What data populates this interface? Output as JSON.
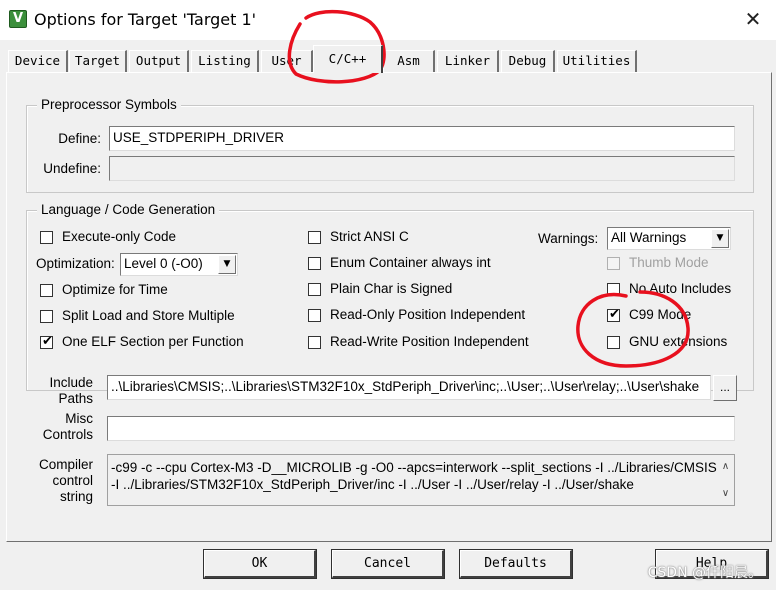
{
  "window": {
    "title": "Options for Target 'Target 1'",
    "close_glyph": "✕",
    "app_icon_glyph": "V"
  },
  "tabs": [
    "Device",
    "Target",
    "Output",
    "Listing",
    "User",
    "C/C++",
    "Asm",
    "Linker",
    "Debug",
    "Utilities"
  ],
  "active_tab": "C/C++",
  "preprocessor": {
    "legend": "Preprocessor Symbols",
    "define_label": "Define:",
    "define_value": "USE_STDPERIPH_DRIVER",
    "undefine_label": "Undefine:",
    "undefine_value": ""
  },
  "codegen": {
    "legend": "Language / Code Generation",
    "execute_only": {
      "label": "Execute-only Code",
      "checked": false
    },
    "optimization_label": "Optimization:",
    "optimization_value": "Level 0 (-O0)",
    "optimize_time": {
      "label": "Optimize for Time",
      "checked": false
    },
    "split_load": {
      "label": "Split Load and Store Multiple",
      "checked": false
    },
    "one_elf": {
      "label": "One ELF Section per Function",
      "checked": true
    },
    "strict_ansi": {
      "label": "Strict ANSI C",
      "checked": false
    },
    "enum_container": {
      "label": "Enum Container always int",
      "checked": false
    },
    "plain_char": {
      "label": "Plain Char is Signed",
      "checked": false
    },
    "ropi": {
      "label": "Read-Only Position Independent",
      "checked": false
    },
    "rwpi": {
      "label": "Read-Write Position Independent",
      "checked": false
    },
    "warnings_label": "Warnings:",
    "warnings_value": "All Warnings",
    "thumb_mode": {
      "label": "Thumb Mode",
      "checked": false
    },
    "no_auto_includes": {
      "label": "No Auto Includes",
      "checked": false
    },
    "c99_mode": {
      "label": "C99 Mode",
      "checked": true
    },
    "gnu_extensions": {
      "label": "GNU extensions",
      "checked": false
    }
  },
  "include_paths": {
    "label_line1": "Include",
    "label_line2": "Paths",
    "value": "..\\Libraries\\CMSIS;..\\Libraries\\STM32F10x_StdPeriph_Driver\\inc;..\\User;..\\User\\relay;..\\User\\shake",
    "browse_label": "..."
  },
  "misc_controls": {
    "label_line1": "Misc",
    "label_line2": "Controls",
    "value": ""
  },
  "compiler_string": {
    "label_line1": "Compiler",
    "label_line2": "control",
    "label_line3": "string",
    "line1": "-c99 -c --cpu Cortex-M3 -D__MICROLIB -g -O0 --apcs=interwork --split_sections -I ../Libraries/CMSIS",
    "line2": "-I ../Libraries/STM32F10x_StdPeriph_Driver/inc -I ../User -I ../User/relay -I ../User/shake"
  },
  "buttons": {
    "ok": "OK",
    "cancel": "Cancel",
    "defaults": "Defaults",
    "help": "Help"
  },
  "watermark": "CSDN @仟阳晨。",
  "annotation_color": "#e8101e"
}
